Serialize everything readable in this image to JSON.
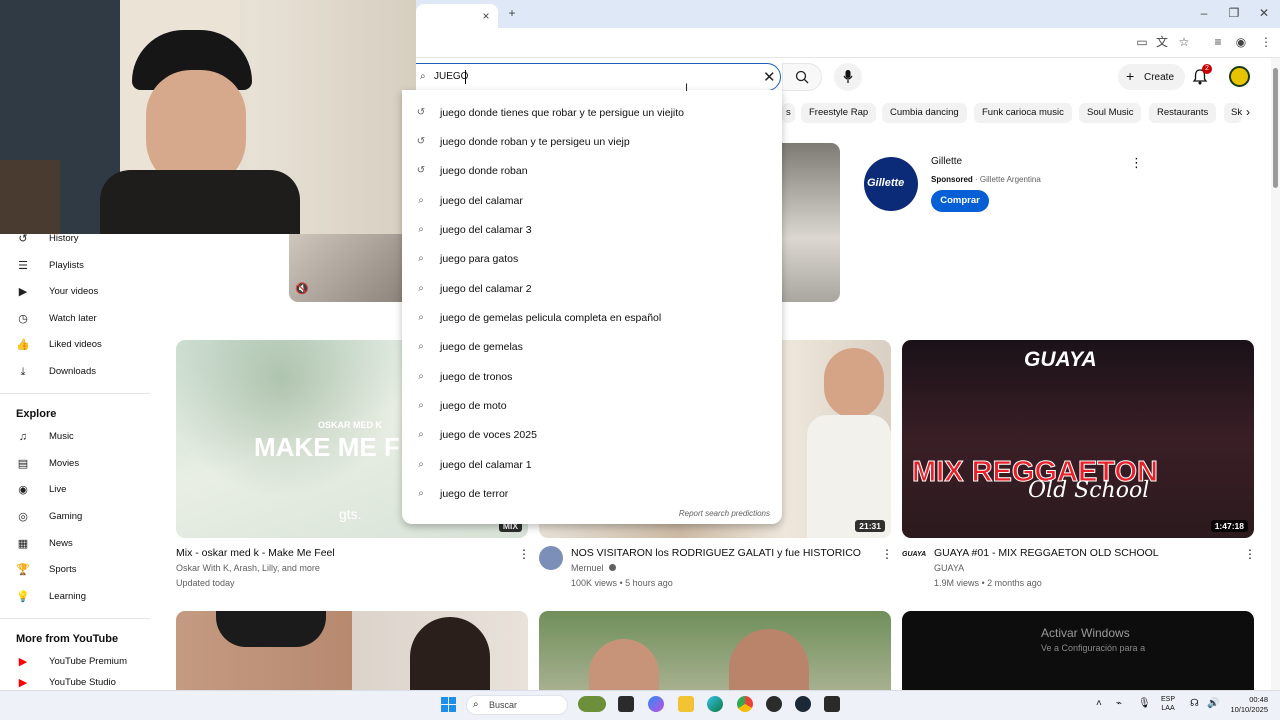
{
  "browser": {
    "tab_close": "×",
    "new_tab": "+"
  },
  "search": {
    "query": "JUEGO",
    "suggestions": [
      {
        "text": "juego donde tienes que robar y te persigue un viejito",
        "icon": "history-icon"
      },
      {
        "text": "juego donde roban y te persigeu un viejp",
        "icon": "history-icon"
      },
      {
        "text": "juego donde roban",
        "icon": "history-icon"
      },
      {
        "text": "juego del calamar",
        "icon": "search-icon"
      },
      {
        "text": "juego del calamar 3",
        "icon": "search-icon"
      },
      {
        "text": "juego para gatos",
        "icon": "search-icon"
      },
      {
        "text": "juego del calamar 2",
        "icon": "search-icon"
      },
      {
        "text": "juego de gemelas pelicula completa en español",
        "icon": "search-icon"
      },
      {
        "text": "juego de gemelas",
        "icon": "search-icon"
      },
      {
        "text": "juego de tronos",
        "icon": "search-icon"
      },
      {
        "text": "juego de moto",
        "icon": "search-icon"
      },
      {
        "text": "juego de voces 2025",
        "icon": "search-icon"
      },
      {
        "text": "juego del calamar 1",
        "icon": "search-icon"
      },
      {
        "text": "juego de terror",
        "icon": "search-icon"
      }
    ],
    "report": "Report search predictions"
  },
  "header": {
    "create": "Create",
    "notif_count": "2"
  },
  "chips": [
    "s",
    "Freestyle Rap",
    "Cumbia dancing",
    "Funk carioca music",
    "Soul Music",
    "Restaurants",
    "Sk"
  ],
  "sidebar": {
    "items": [
      "History",
      "Playlists",
      "Your videos",
      "Watch later",
      "Liked videos",
      "Downloads"
    ],
    "explore_title": "Explore",
    "explore": [
      "Music",
      "Movies",
      "Live",
      "Gaming",
      "News",
      "Sports",
      "Learning"
    ],
    "more_title": "More from YouTube",
    "more": [
      "YouTube Premium",
      "YouTube Studio"
    ]
  },
  "ad": {
    "brand": "Gillette",
    "logo_text": "Gillette",
    "sponsored": "Sponsored",
    "advertiser": "Gillette Argentina",
    "cta": "Comprar"
  },
  "videos": [
    {
      "title": "Mix - oskar med k - Make Me Feel",
      "meta1": "Oskar With K, Arash, Lilly, and more",
      "meta2": "Updated today",
      "thumb_text_top": "OSKAR MED K",
      "thumb_text": "MAKE ME F",
      "thumb_sub": "gts.",
      "badge": "MIX"
    },
    {
      "title": "NOS VISITARON los RODRIGUEZ GALATI y fue HISTORICO",
      "meta1": "Mernuel",
      "meta2": "100K views • 5 hours ago",
      "duration": "21:31"
    },
    {
      "title": "GUAYA #01 - MIX REGGAETON OLD SCHOOL",
      "meta1": "GUAYA",
      "meta2": "1.9M views • 2 months ago",
      "duration": "1:47:18",
      "thumb_top": "GUAYA",
      "thumb_main": "MIX REGGAETON",
      "thumb_sub": "Old School",
      "channel_logo": "GUAYA"
    }
  ],
  "watermark": {
    "line1": "Activar Windows",
    "line2": "Ve a Configuración para a"
  },
  "taskbar": {
    "search": "Buscar",
    "lang1": "ESP",
    "lang2": "LAA",
    "time": "00:48",
    "date": "10/10/2025"
  },
  "colors": {
    "accent": "#065fd4",
    "red": "#ff0000",
    "search_border": "#1c62b9"
  }
}
